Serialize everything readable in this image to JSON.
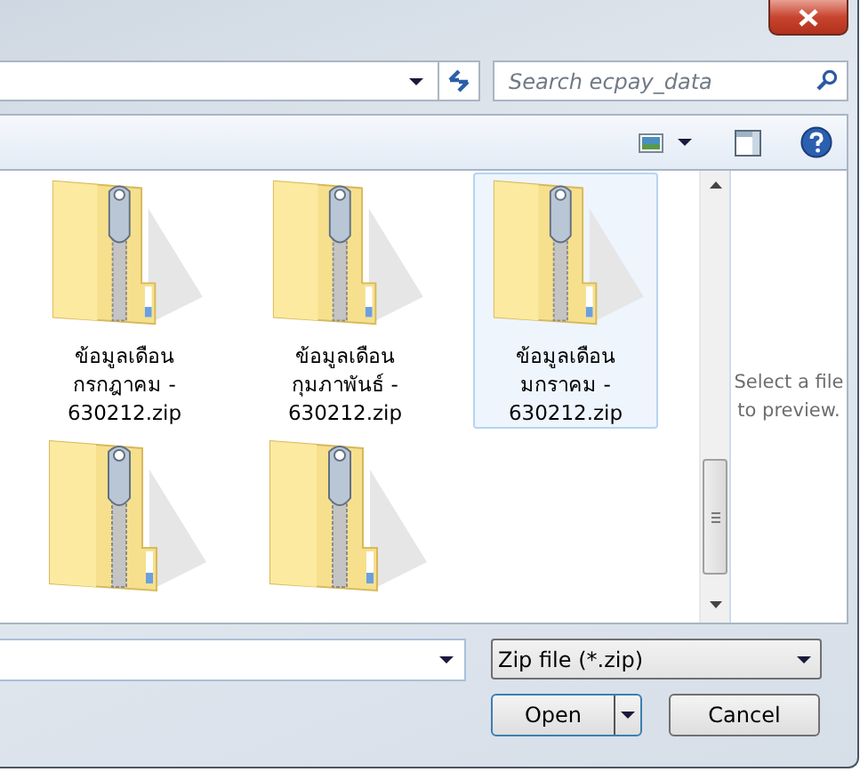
{
  "search": {
    "placeholder": "Search ecpay_data"
  },
  "files": [
    {
      "lines": [
        "ข้อมูลเดือน",
        "กรกฎาคม -",
        "630212.zip"
      ],
      "selected": false
    },
    {
      "lines": [
        "ข้อมูลเดือน",
        "กุมภาพันธ์ -",
        "630212.zip"
      ],
      "selected": false
    },
    {
      "lines": [
        "ข้อมูลเดือน",
        "มกราคม -",
        "630212.zip"
      ],
      "selected": true
    },
    {
      "selected": false
    },
    {
      "selected": false
    }
  ],
  "preview_text": "Select a file to preview.",
  "file_type": "Zip file (*.zip)",
  "buttons": {
    "open": "Open",
    "cancel": "Cancel"
  }
}
